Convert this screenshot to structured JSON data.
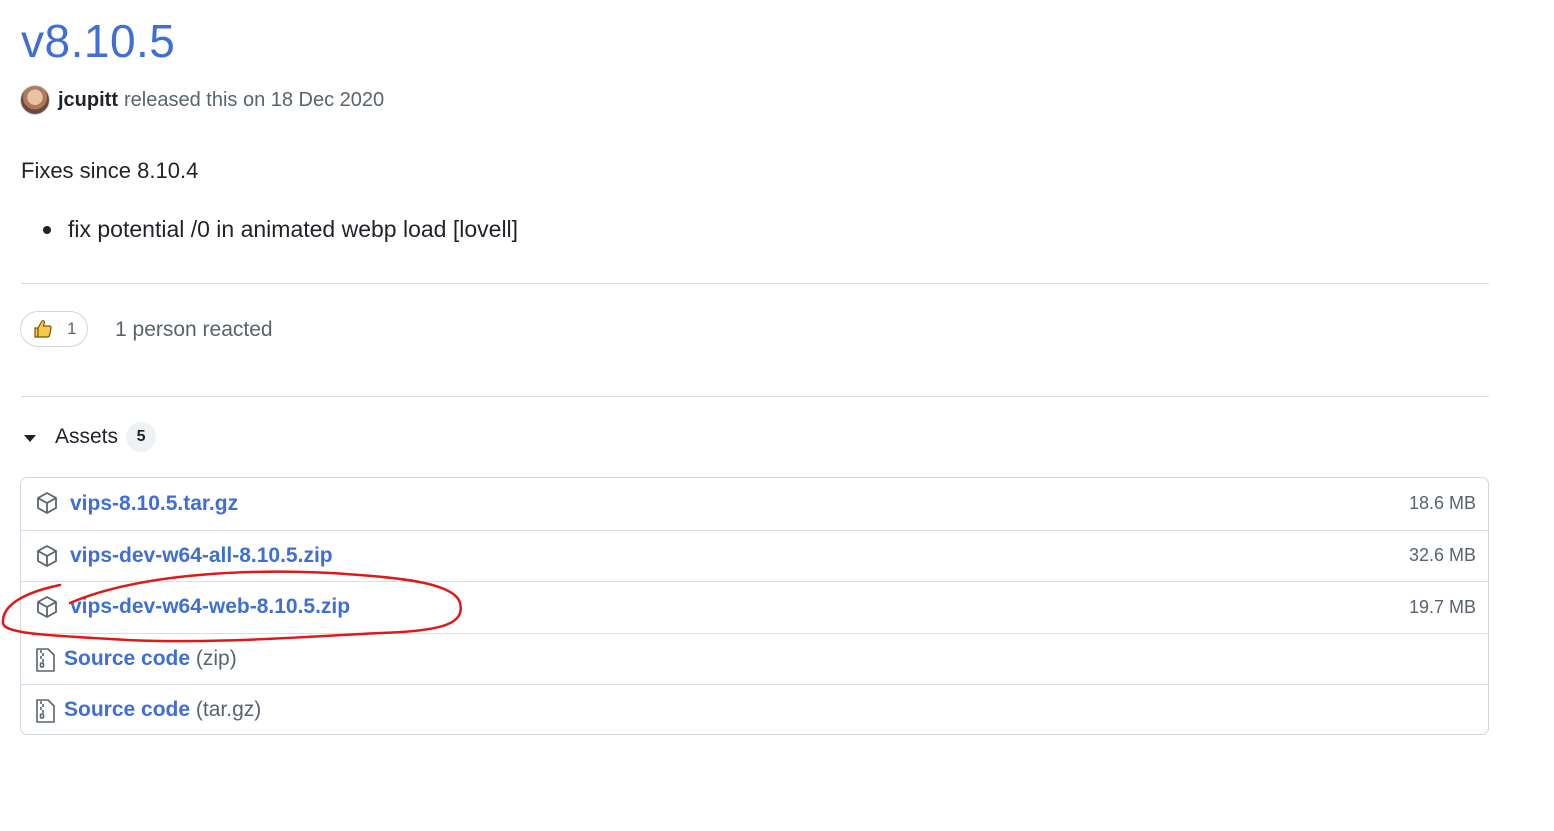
{
  "release": {
    "title": "v8.10.5",
    "author": "jcupitt",
    "released_text": "released this on 18 Dec 2020"
  },
  "notes": {
    "heading": "Fixes since 8.10.4",
    "items": [
      "fix potential /0 in animated webp load [lovell]"
    ]
  },
  "reactions": {
    "emoji": "thumbs-up-icon",
    "count": "1",
    "summary": "1 person reacted"
  },
  "assets": {
    "label": "Assets",
    "count": "5",
    "files": [
      {
        "name": "vips-8.10.5.tar.gz",
        "size": "18.6 MB"
      },
      {
        "name": "vips-dev-w64-all-8.10.5.zip",
        "size": "32.6 MB"
      },
      {
        "name": "vips-dev-w64-web-8.10.5.zip",
        "size": "19.7 MB"
      }
    ],
    "sources": [
      {
        "name": "Source code",
        "ext": "(zip)"
      },
      {
        "name": "Source code",
        "ext": "(tar.gz)"
      }
    ]
  },
  "colors": {
    "link": "#3f6fd6",
    "muted": "#59636e",
    "annotation": "#e01818"
  }
}
